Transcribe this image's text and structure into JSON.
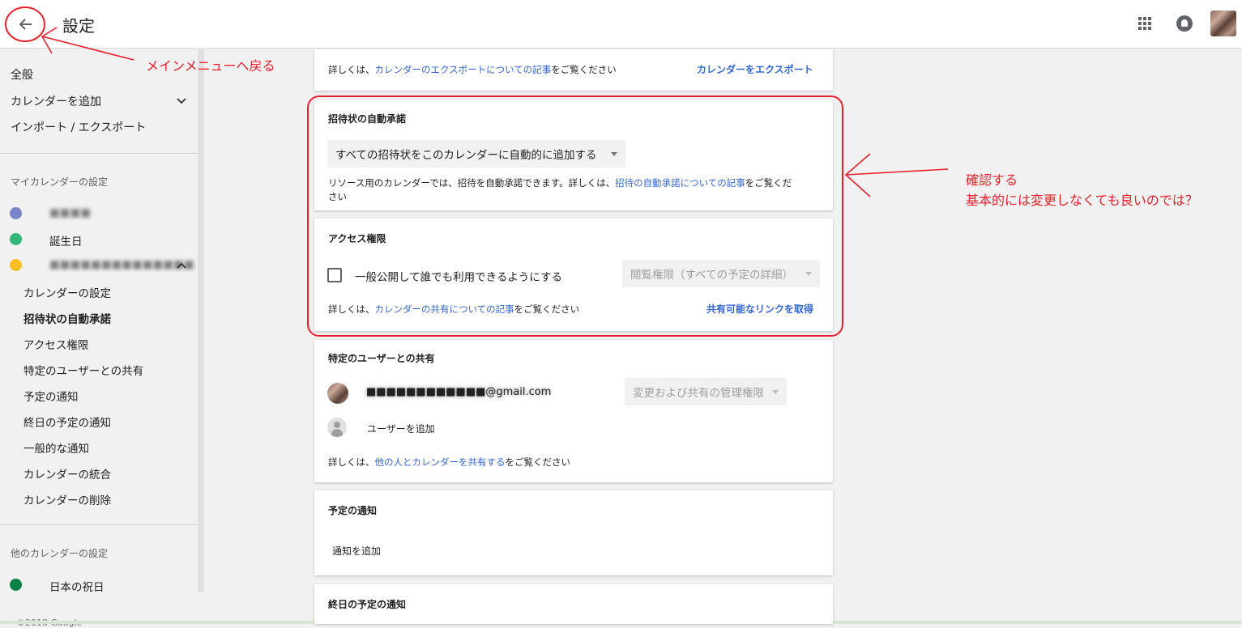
{
  "header": {
    "title": "設定",
    "back_icon": "arrow-back-icon"
  },
  "sidebar": {
    "general": "全般",
    "add_calendar": "カレンダーを追加",
    "import_export": "インポート / エクスポート",
    "my_calendars_heading": "マイカレンダーの設定",
    "my_calendars": [
      {
        "name": "■■■■",
        "color": "#7986cb"
      },
      {
        "name": "誕生日",
        "color": "#33b679"
      },
      {
        "name": "■■■■■■■■■■■■■■",
        "color": "#f6bf26"
      }
    ],
    "sub_items": [
      "カレンダーの設定",
      "招待状の自動承諾",
      "アクセス権限",
      "特定のユーザーとの共有",
      "予定の通知",
      "終日の予定の通知",
      "一般的な通知",
      "カレンダーの統合",
      "カレンダーの削除"
    ],
    "other_calendars_heading": "他のカレンダーの設定",
    "other_calendars": [
      {
        "name": "日本の祝日",
        "color": "#0b8043"
      }
    ],
    "footer": "©2018 Google"
  },
  "export_card": {
    "text_prefix": "詳しくは、",
    "link": "カレンダーのエクスポートについての記事",
    "text_suffix": "をご覧ください",
    "action": "カレンダーをエクスポート"
  },
  "invite_card": {
    "title": "招待状の自動承諾",
    "select_value": "すべての招待状をこのカレンダーに自動的に追加する",
    "desc_prefix": "リソース用のカレンダーでは、招待を自動承諾できます。詳しくは、",
    "link": "招待の自動承諾についての記事",
    "desc_suffix_line1": "をご覧くだ",
    "desc_line2": "さい"
  },
  "access_card": {
    "title": "アクセス権限",
    "checkbox_label": "一般公開して誰でも利用できるようにする",
    "checkbox_checked": false,
    "permission_select": "閲覧権限（すべての予定の詳細）",
    "text_prefix": "詳しくは、",
    "link": "カレンダーの共有についての記事",
    "text_suffix": "をご覧ください",
    "action": "共有可能なリンクを取得"
  },
  "share_card": {
    "title": "特定のユーザーとの共有",
    "user_email": "■■■■■■■■■■■■@gmail.com",
    "user_permission": "変更および共有の管理権限",
    "add_user": "ユーザーを追加",
    "text_prefix": "詳しくは、",
    "link": "他の人とカレンダーを共有する",
    "text_suffix": "をご覧ください"
  },
  "event_notify_card": {
    "title": "予定の通知",
    "add": "通知を追加"
  },
  "allday_notify_card": {
    "title": "終日の予定の通知"
  },
  "annotations": {
    "back_note": "メインメニューへ戻る",
    "check_note_line1": "確認する",
    "check_note_line2": "基本的には変更しなくても良いのでは？",
    "color": "#e8212b"
  }
}
